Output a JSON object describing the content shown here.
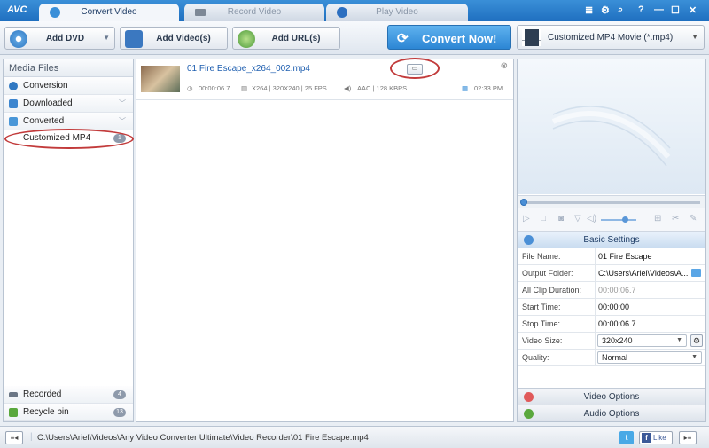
{
  "app": {
    "logo": "AVC"
  },
  "tabs": [
    {
      "label": "Convert Video",
      "active": true
    },
    {
      "label": "Record Video",
      "active": false
    },
    {
      "label": "Play Video",
      "active": false
    }
  ],
  "window_controls": {
    "menu": "≣",
    "settings": "⚙",
    "search": "⌕",
    "help": "?",
    "minimize": "—",
    "maximize": "☐",
    "close": "✕"
  },
  "toolbar": {
    "add_dvd": "Add DVD",
    "add_videos": "Add Video(s)",
    "add_urls": "Add URL(s)",
    "convert_now": "Convert Now!",
    "profile": "Customized MP4 Movie (*.mp4)"
  },
  "sidebar": {
    "title": "Media Files",
    "items": [
      {
        "label": "Conversion"
      },
      {
        "label": "Downloaded"
      },
      {
        "label": "Converted"
      }
    ],
    "sub_item": {
      "label": "Customized MP4",
      "count": "1"
    },
    "bottom_items": [
      {
        "label": "Recorded",
        "count": "4"
      },
      {
        "label": "Recycle bin",
        "count": "13"
      }
    ]
  },
  "file": {
    "name": "01 Fire Escape_x264_002.mp4",
    "duration": "00:00:06.7",
    "video_info": "X264 | 320X240 | 25 FPS",
    "audio_info": "AAC | 128 KBPS",
    "time": "02:33 PM"
  },
  "basic_settings": {
    "title": "Basic Settings",
    "rows": [
      {
        "label": "File Name:",
        "value": "01 Fire Escape"
      },
      {
        "label": "Output Folder:",
        "value": "C:\\Users\\Ariel\\Videos\\A..."
      },
      {
        "label": "All Clip Duration:",
        "value": "00:00:06.7"
      },
      {
        "label": "Start Time:",
        "value": "00:00:00"
      },
      {
        "label": "Stop Time:",
        "value": "00:00:06.7"
      },
      {
        "label": "Video Size:",
        "value": "320x240"
      },
      {
        "label": "Quality:",
        "value": "Normal"
      }
    ]
  },
  "options": {
    "video": "Video Options",
    "audio": "Audio Options"
  },
  "status": {
    "path": "C:\\Users\\Ariel\\Videos\\Any Video Converter Ultimate\\Video Recorder\\01 Fire Escape.mp4",
    "like": "Like"
  },
  "colors": {
    "accent": "#2c86d4",
    "highlight_circle": "#c23b3b",
    "link": "#1f5fb0"
  }
}
